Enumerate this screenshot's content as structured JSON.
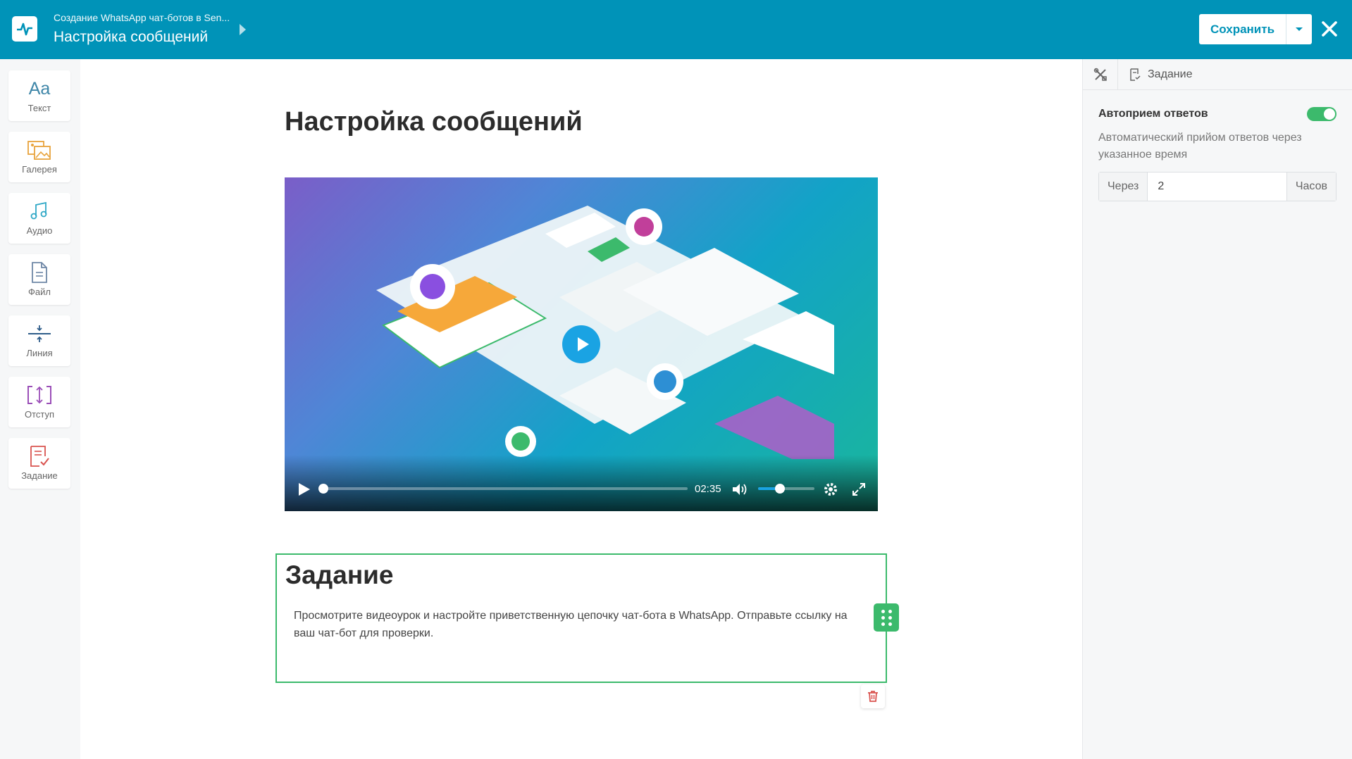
{
  "header": {
    "subtitle": "Создание WhatsApp чат-ботов в Sen...",
    "title": "Настройка сообщений",
    "save_label": "Сохранить",
    "bg_color": "#0093b8"
  },
  "toolbar": {
    "items": [
      {
        "label": "Текст",
        "icon": "text-icon"
      },
      {
        "label": "Галерея",
        "icon": "gallery-icon"
      },
      {
        "label": "Аудио",
        "icon": "audio-icon"
      },
      {
        "label": "Файл",
        "icon": "file-icon"
      },
      {
        "label": "Линия",
        "icon": "line-icon"
      },
      {
        "label": "Отступ",
        "icon": "spacing-icon"
      },
      {
        "label": "Задание",
        "icon": "task-icon"
      }
    ],
    "text_icon_glyph": "Aa"
  },
  "main": {
    "heading": "Настройка сообщений",
    "video": {
      "duration": "02:35"
    },
    "task": {
      "heading": "Задание",
      "text": "Просмотрите видеоурок и настройте приветственную цепочку чат-бота в WhatsApp. Отправьте ссылку на ваш чат-бот для проверки."
    }
  },
  "panel": {
    "tab_label": "Задание",
    "auto_label": "Автоприем ответов",
    "auto_enabled": true,
    "auto_desc": "Автоматический прийом ответов через указанное время",
    "prefix": "Через",
    "value": "2",
    "suffix": "Часов",
    "accent_color": "#3cba6c"
  }
}
